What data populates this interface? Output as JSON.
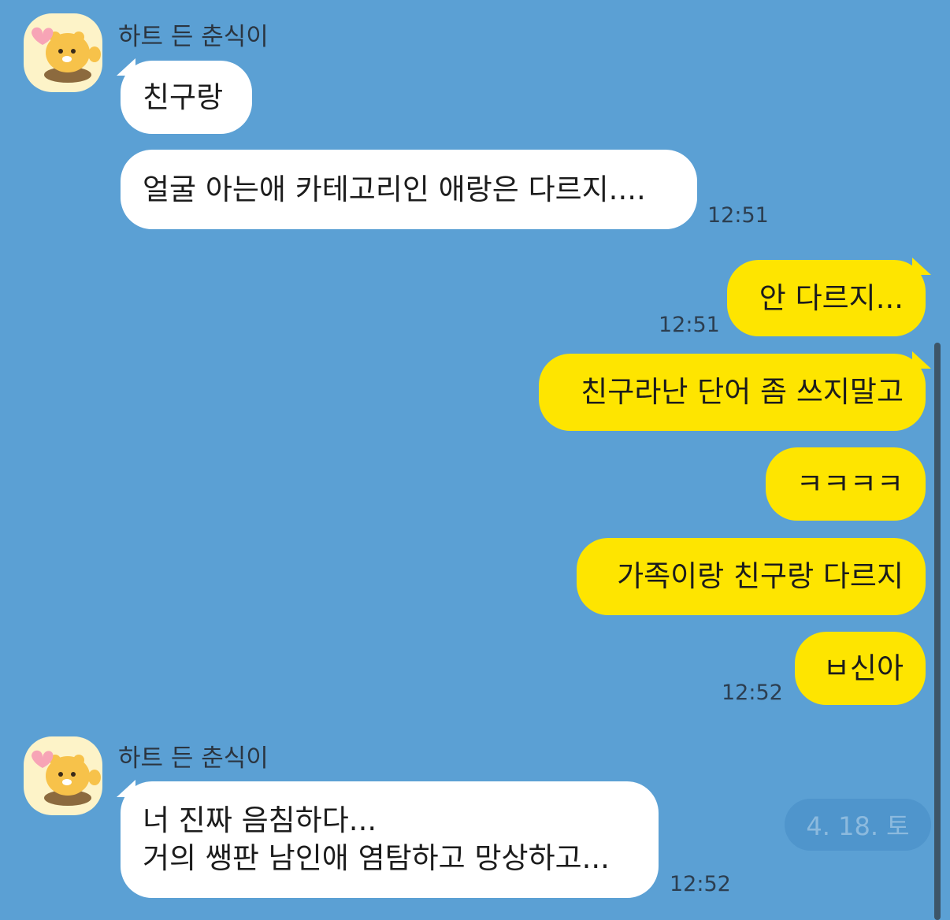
{
  "sender_name": "하트 든 춘식이",
  "avatar_icon": "chunsik-heart-avatar-icon",
  "groups": [
    {
      "side": "in",
      "messages": [
        "친구랑",
        "얼굴 아는애 카테고리인 애랑은 다르지...."
      ],
      "time": "12:51"
    },
    {
      "side": "out",
      "messages": [
        "안 다르지..."
      ],
      "time": "12:51"
    },
    {
      "side": "out",
      "messages": [
        "친구라난 단어 좀 쓰지말고",
        "ㅋㅋㅋㅋ",
        "가족이랑 친구랑 다르지",
        "ㅂ신아"
      ],
      "time": "12:52"
    },
    {
      "side": "in",
      "messages": [
        "너 진짜 음침하다...",
        "거의 쌩판 남인애 염탐하고 망상하고..."
      ],
      "time": "12:52"
    }
  ],
  "date_chip": "4. 18. 토",
  "colors": {
    "background": "#5ba0d4",
    "incoming_bubble": "#ffffff",
    "outgoing_bubble": "#fee500"
  }
}
